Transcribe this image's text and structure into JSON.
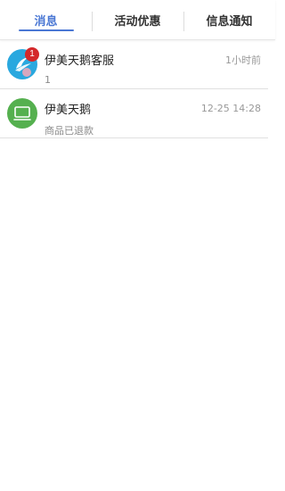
{
  "tabs": [
    {
      "label": "消息",
      "active": true
    },
    {
      "label": "活动优惠",
      "active": false
    },
    {
      "label": "信息通知",
      "active": false
    }
  ],
  "messages": [
    {
      "name": "伊美天鹅客服",
      "time": "1小时前",
      "preview": "1",
      "badge": "1",
      "avatar_icon": "swan-logo-icon",
      "avatar_color": "#29a8df"
    },
    {
      "name": "伊美天鹅",
      "time": "12-25 14:28",
      "preview": "商品已退款",
      "badge": "",
      "avatar_icon": "store-icon",
      "avatar_color": "#55b04f"
    }
  ],
  "colors": {
    "accent": "#4a77d4",
    "badge": "#d4282a"
  }
}
